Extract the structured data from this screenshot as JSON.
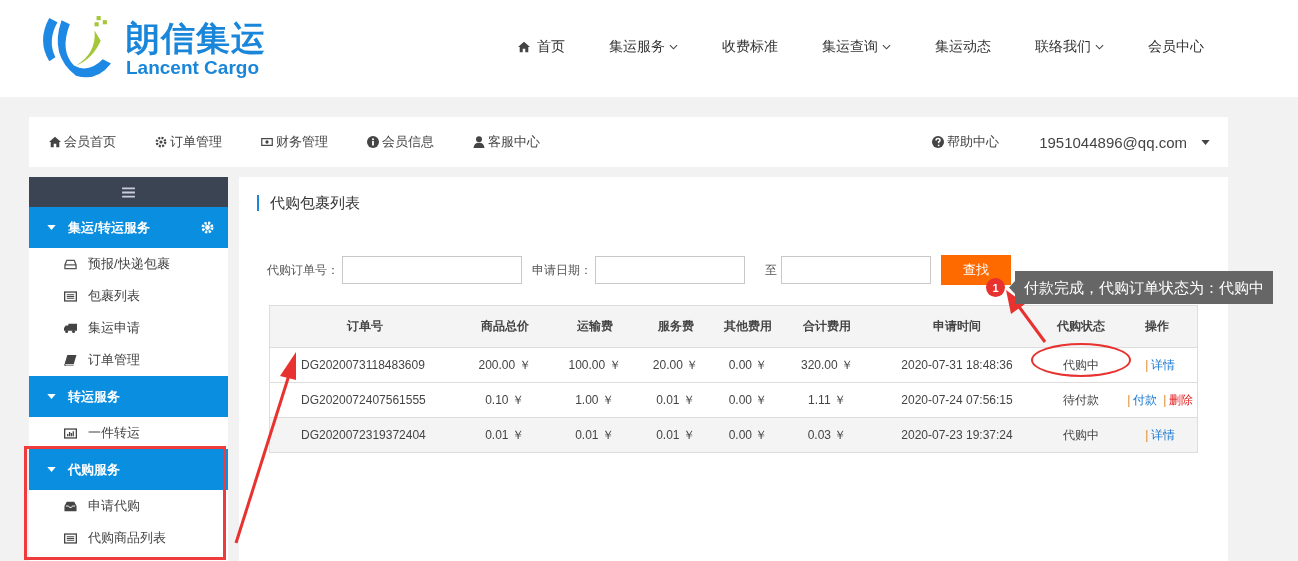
{
  "logo": {
    "name": "朗信集运",
    "subtitle": "Lancent Cargo"
  },
  "top_nav": [
    {
      "label": "首页",
      "dropdown": false
    },
    {
      "label": "集运服务",
      "dropdown": true
    },
    {
      "label": "收费标准",
      "dropdown": false
    },
    {
      "label": "集运查询",
      "dropdown": true
    },
    {
      "label": "集运动态",
      "dropdown": false
    },
    {
      "label": "联络我们",
      "dropdown": true
    },
    {
      "label": "会员中心",
      "dropdown": false
    }
  ],
  "member_bar": {
    "items": [
      {
        "label": "会员首页"
      },
      {
        "label": "订单管理"
      },
      {
        "label": "财务管理"
      },
      {
        "label": "会员信息"
      },
      {
        "label": "客服中心"
      }
    ],
    "help": {
      "label": "帮助中心"
    },
    "account": "1951044896@qq.com"
  },
  "sidebar": {
    "groups": [
      {
        "title": "集运/转运服务",
        "expanded": true,
        "settings": true,
        "items": [
          {
            "label": "预报/快递包裹"
          },
          {
            "label": "包裹列表"
          },
          {
            "label": "集运申请"
          },
          {
            "label": "订单管理"
          }
        ]
      },
      {
        "title": "转运服务",
        "expanded": true,
        "settings": false,
        "items": [
          {
            "label": "一件转运"
          }
        ]
      },
      {
        "title": "代购服务",
        "expanded": true,
        "settings": false,
        "items": [
          {
            "label": "申请代购"
          },
          {
            "label": "代购商品列表"
          }
        ]
      }
    ]
  },
  "panel": {
    "title": "代购包裹列表",
    "filters": {
      "order_label": "代购订单号：",
      "date_label": "申请日期：",
      "to_label": "至",
      "search_button": "查找"
    },
    "table": {
      "columns": [
        "订单号",
        "商品总价",
        "运输费",
        "服务费",
        "其他费用",
        "合计费用",
        "申请时间",
        "代购状态",
        "操作"
      ],
      "rows": [
        {
          "cells": [
            "DG2020073118483609",
            "200.00 ￥",
            "100.00 ￥",
            "20.00 ￥",
            "0.00 ￥",
            "320.00 ￥",
            "2020-07-31 18:48:36",
            "代购中"
          ],
          "actions": [
            {
              "separator": "|",
              "label": "详情",
              "kind": "link"
            }
          ]
        },
        {
          "cells": [
            "DG2020072407561555",
            "0.10 ￥",
            "1.00 ￥",
            "0.01 ￥",
            "0.00 ￥",
            "1.11 ￥",
            "2020-07-24 07:56:15",
            "待付款"
          ],
          "actions": [
            {
              "separator": "|",
              "label": "付款",
              "kind": "link"
            },
            {
              "separator": "|",
              "label": "删除",
              "kind": "danger"
            }
          ]
        },
        {
          "cells": [
            "DG2020072319372404",
            "0.01 ￥",
            "0.01 ￥",
            "0.01 ￥",
            "0.00 ￥",
            "0.03 ￥",
            "2020-07-23 19:37:24",
            "代购中"
          ],
          "actions": [
            {
              "separator": "|",
              "label": "详情",
              "kind": "link"
            }
          ]
        }
      ]
    }
  },
  "annotation": {
    "badge": "1",
    "note": "付款完成，代购订单状态为：代购中"
  }
}
